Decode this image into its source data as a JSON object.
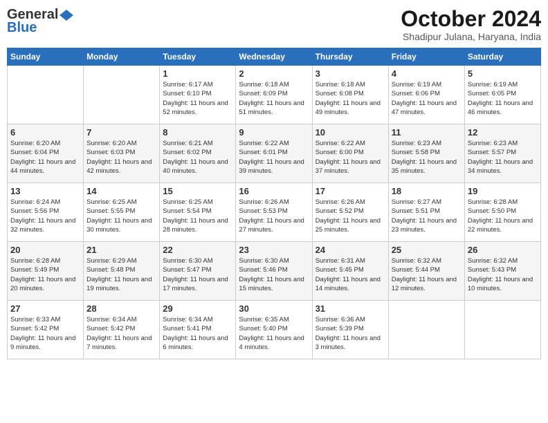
{
  "logo": {
    "general": "General",
    "blue": "Blue"
  },
  "title": "October 2024",
  "location": "Shadipur Julana, Haryana, India",
  "days_header": [
    "Sunday",
    "Monday",
    "Tuesday",
    "Wednesday",
    "Thursday",
    "Friday",
    "Saturday"
  ],
  "weeks": [
    [
      {
        "day": "",
        "info": ""
      },
      {
        "day": "",
        "info": ""
      },
      {
        "day": "1",
        "info": "Sunrise: 6:17 AM\nSunset: 6:10 PM\nDaylight: 11 hours and 52 minutes."
      },
      {
        "day": "2",
        "info": "Sunrise: 6:18 AM\nSunset: 6:09 PM\nDaylight: 11 hours and 51 minutes."
      },
      {
        "day": "3",
        "info": "Sunrise: 6:18 AM\nSunset: 6:08 PM\nDaylight: 11 hours and 49 minutes."
      },
      {
        "day": "4",
        "info": "Sunrise: 6:19 AM\nSunset: 6:06 PM\nDaylight: 11 hours and 47 minutes."
      },
      {
        "day": "5",
        "info": "Sunrise: 6:19 AM\nSunset: 6:05 PM\nDaylight: 11 hours and 46 minutes."
      }
    ],
    [
      {
        "day": "6",
        "info": "Sunrise: 6:20 AM\nSunset: 6:04 PM\nDaylight: 11 hours and 44 minutes."
      },
      {
        "day": "7",
        "info": "Sunrise: 6:20 AM\nSunset: 6:03 PM\nDaylight: 11 hours and 42 minutes."
      },
      {
        "day": "8",
        "info": "Sunrise: 6:21 AM\nSunset: 6:02 PM\nDaylight: 11 hours and 40 minutes."
      },
      {
        "day": "9",
        "info": "Sunrise: 6:22 AM\nSunset: 6:01 PM\nDaylight: 11 hours and 39 minutes."
      },
      {
        "day": "10",
        "info": "Sunrise: 6:22 AM\nSunset: 6:00 PM\nDaylight: 11 hours and 37 minutes."
      },
      {
        "day": "11",
        "info": "Sunrise: 6:23 AM\nSunset: 5:58 PM\nDaylight: 11 hours and 35 minutes."
      },
      {
        "day": "12",
        "info": "Sunrise: 6:23 AM\nSunset: 5:57 PM\nDaylight: 11 hours and 34 minutes."
      }
    ],
    [
      {
        "day": "13",
        "info": "Sunrise: 6:24 AM\nSunset: 5:56 PM\nDaylight: 11 hours and 32 minutes."
      },
      {
        "day": "14",
        "info": "Sunrise: 6:25 AM\nSunset: 5:55 PM\nDaylight: 11 hours and 30 minutes."
      },
      {
        "day": "15",
        "info": "Sunrise: 6:25 AM\nSunset: 5:54 PM\nDaylight: 11 hours and 28 minutes."
      },
      {
        "day": "16",
        "info": "Sunrise: 6:26 AM\nSunset: 5:53 PM\nDaylight: 11 hours and 27 minutes."
      },
      {
        "day": "17",
        "info": "Sunrise: 6:26 AM\nSunset: 5:52 PM\nDaylight: 11 hours and 25 minutes."
      },
      {
        "day": "18",
        "info": "Sunrise: 6:27 AM\nSunset: 5:51 PM\nDaylight: 11 hours and 23 minutes."
      },
      {
        "day": "19",
        "info": "Sunrise: 6:28 AM\nSunset: 5:50 PM\nDaylight: 11 hours and 22 minutes."
      }
    ],
    [
      {
        "day": "20",
        "info": "Sunrise: 6:28 AM\nSunset: 5:49 PM\nDaylight: 11 hours and 20 minutes."
      },
      {
        "day": "21",
        "info": "Sunrise: 6:29 AM\nSunset: 5:48 PM\nDaylight: 11 hours and 19 minutes."
      },
      {
        "day": "22",
        "info": "Sunrise: 6:30 AM\nSunset: 5:47 PM\nDaylight: 11 hours and 17 minutes."
      },
      {
        "day": "23",
        "info": "Sunrise: 6:30 AM\nSunset: 5:46 PM\nDaylight: 11 hours and 15 minutes."
      },
      {
        "day": "24",
        "info": "Sunrise: 6:31 AM\nSunset: 5:45 PM\nDaylight: 11 hours and 14 minutes."
      },
      {
        "day": "25",
        "info": "Sunrise: 6:32 AM\nSunset: 5:44 PM\nDaylight: 11 hours and 12 minutes."
      },
      {
        "day": "26",
        "info": "Sunrise: 6:32 AM\nSunset: 5:43 PM\nDaylight: 11 hours and 10 minutes."
      }
    ],
    [
      {
        "day": "27",
        "info": "Sunrise: 6:33 AM\nSunset: 5:42 PM\nDaylight: 11 hours and 9 minutes."
      },
      {
        "day": "28",
        "info": "Sunrise: 6:34 AM\nSunset: 5:42 PM\nDaylight: 11 hours and 7 minutes."
      },
      {
        "day": "29",
        "info": "Sunrise: 6:34 AM\nSunset: 5:41 PM\nDaylight: 11 hours and 6 minutes."
      },
      {
        "day": "30",
        "info": "Sunrise: 6:35 AM\nSunset: 5:40 PM\nDaylight: 11 hours and 4 minutes."
      },
      {
        "day": "31",
        "info": "Sunrise: 6:36 AM\nSunset: 5:39 PM\nDaylight: 11 hours and 3 minutes."
      },
      {
        "day": "",
        "info": ""
      },
      {
        "day": "",
        "info": ""
      }
    ]
  ]
}
